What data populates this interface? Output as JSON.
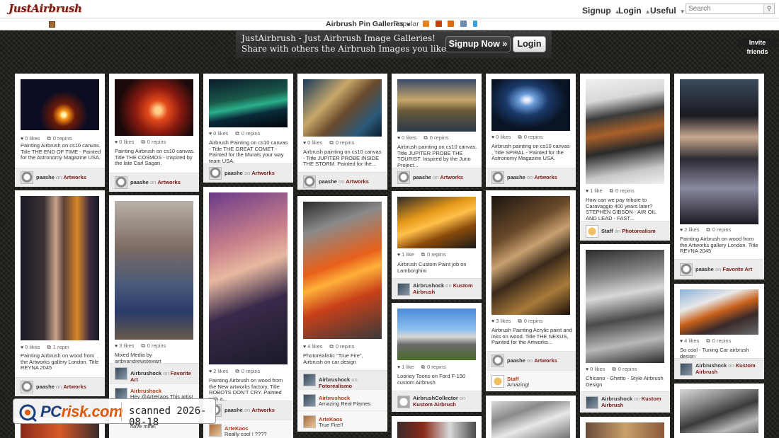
{
  "site": {
    "logo": "JustAirbrush"
  },
  "topnav": {
    "signup": "Signup",
    "login": "Login",
    "useful": "Useful",
    "search_placeholder": "Search"
  },
  "subnav": {
    "galleries": "Airbrush Pin Galleries",
    "popular": "Popular",
    "invite": "Invite friends"
  },
  "banner": {
    "line1": "JustAirbrush - Just Airbrush Image Galleries!",
    "line2": "Share with others the Airbrush Images you like.",
    "signup_button": "Signup Now »",
    "login_button": "Login"
  },
  "pins": [
    {
      "likes": "0 likes",
      "repins": "0 repins",
      "desc": "Painting Airbrush on cs10 canvas. Title THE END OF TIME - Painted for the Astronomy Magazine USA.",
      "user": "paashe",
      "on": "on",
      "board": "Artworks"
    },
    {
      "likes": "0 likes",
      "repins": "0 repins",
      "desc": "Painting Airbrush on cs10 canvas. Title THE COSMOS - Inspired by the late Carl Sagan.",
      "user": "paashe",
      "on": "on",
      "board": "Artworks"
    },
    {
      "likes": "0 likes",
      "repins": "0 repins",
      "desc": "Airbrush Painting on cs10 canvas - Title THE GREAT COMET - Painted for the Murals your way team USA.",
      "user": "paashe",
      "on": "on",
      "board": "Artworks"
    },
    {
      "likes": "0 likes",
      "repins": "0 repins",
      "desc": "Airbrush painting on cs10 canvas - Title JUPITER PROBE INSIDE THE STORM. Painted for the...",
      "user": "paashe",
      "on": "on",
      "board": "Artworks"
    },
    {
      "likes": "0 likes",
      "repins": "0 repins",
      "desc": "Airbrush painting on cs10 canvas. Title JUPITER PROBE THE TOURIST. Inspired by the Juno Project...",
      "user": "paashe",
      "on": "on",
      "board": "Artworks"
    },
    {
      "likes": "0 likes",
      "repins": "0 repins",
      "desc": "Airbrush painting on cs10 canvas , Title SPIRAL - Painted for the Astronomy Magazine USA.",
      "user": "paashe",
      "on": "on",
      "board": "Artworks"
    },
    {
      "likes": "1 like",
      "repins": "0 repins",
      "desc": "How can we pay tribute to Caravaggio 400 years later? STEPHEN GIBSON - AIR OIL AND LEAD - FAST...",
      "user": "Staff",
      "on": "on",
      "board": "Photorealism"
    },
    {
      "likes": "2 likes",
      "repins": "0 repins",
      "desc": "Painting Airbrush on wood from the Artworks gallery London. Title REYNA 2045",
      "user": "paashe",
      "on": "on",
      "board": "Favorite Art"
    },
    {
      "likes": "0 likes",
      "repins": "1 repin",
      "desc": "Painting Airbrush on wood from the Artworks gallery London. Title REYNA 2045",
      "user": "paashe",
      "on": "on",
      "board": "Artworks"
    },
    {
      "likes": "3 likes",
      "repins": "0 repins",
      "desc": "Mixed Media by artbyandrewstewart",
      "user": "Airbrushock",
      "on": "on",
      "board": "Favorite Art",
      "comment_user": "Airbrushock",
      "comment": "Hey @ArteKaos This artist was",
      "comment_tail": "have mine."
    },
    {
      "likes": "2 likes",
      "repins": "0 repins",
      "desc": "Painting Airbrush on wood from the New artworks factory, Title ROBOTS DON'T CRY. Painted with a...",
      "user": "paashe",
      "on": "on",
      "board": "Artworks",
      "comment_user": "ArteKaos",
      "comment": "Really cool ! ????"
    },
    {
      "likes": "4 likes",
      "repins": "0 repins",
      "desc": "Photorealistic \"True Fire\", Airbrush on car design",
      "user": "Airbrushock",
      "on": "on",
      "board": "Fotorealismo",
      "comment_user": "Airbrushock",
      "comment": "Amazing Real Flames",
      "comment2_user": "ArteKaos",
      "comment2": "True Fire!!"
    },
    {
      "likes": "1 like",
      "repins": "0 repins",
      "desc": "Airbrush Custom Paint job on Lamborghini",
      "user": "Airbrushock",
      "on": "on",
      "board": "Kustom Airbrush"
    },
    {
      "likes": "3 likes",
      "repins": "0 repins",
      "desc": "Airbrush Painting Acrylic paint and inks on wood. Title THE NEXUS, Painted for the Artworks...",
      "user": "paashe",
      "on": "on",
      "board": "Artworks",
      "comment_user": "Staff",
      "comment": "Amazing!"
    },
    {
      "likes": "4 likes",
      "repins": "0 repins",
      "desc": "So cool - Tuning Car airbrush design",
      "user": "Airbrushock",
      "on": "on",
      "board": "Kustom Airbrush"
    },
    {
      "likes": "1 like",
      "repins": "0 repins",
      "desc": "Looney Toons on Ford F-150 custom Airbrush",
      "user": "AirbrushCollector",
      "on": "on",
      "board": "Kustom Airbrush"
    },
    {
      "likes": "0 likes",
      "repins": "0 repins",
      "desc": "Chicano - Ghetto - Style Airbrush Design",
      "user": "Airbrushock",
      "on": "on",
      "board": "Kustom Airbrush"
    }
  ],
  "colors": {
    "accent": "#7a1a14",
    "background": "#1c1a17",
    "comment_name": "#b33a1a"
  },
  "watermark": {
    "brand_pc": "PC",
    "brand_risk": "risk.com",
    "scanned": "scanned 2026-08-18"
  }
}
